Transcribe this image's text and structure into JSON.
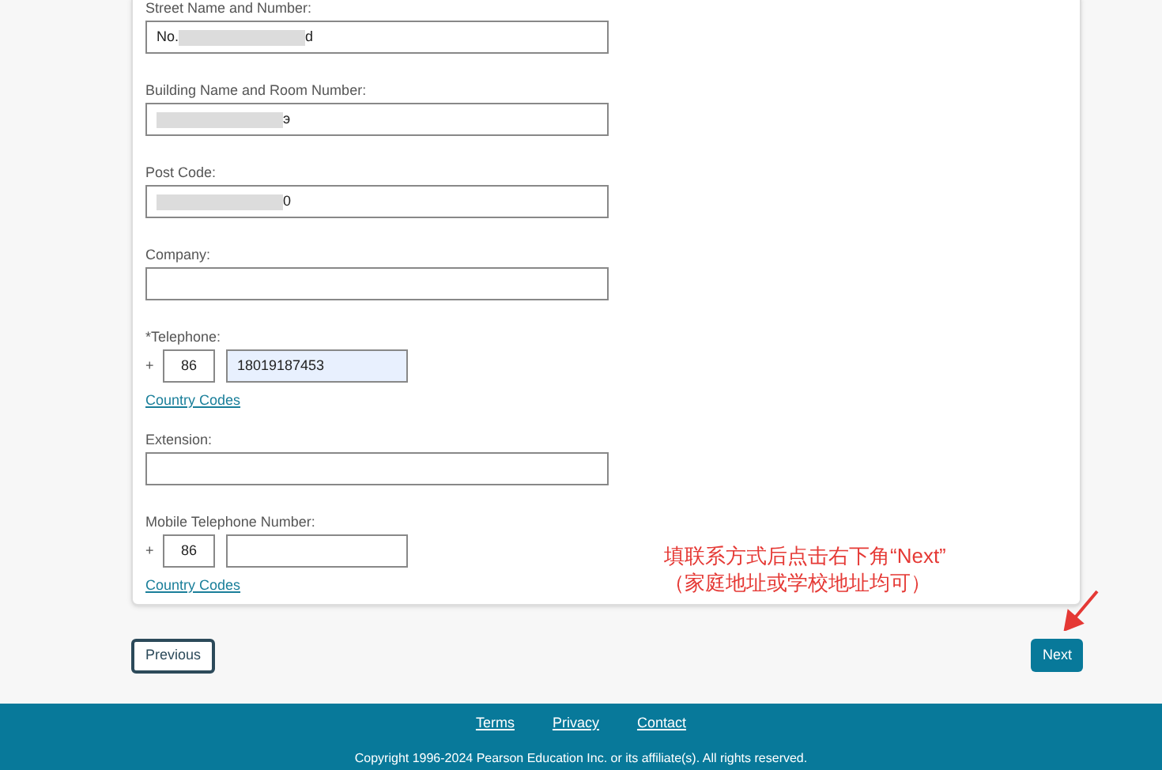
{
  "form": {
    "fields": [
      {
        "kind": "text",
        "label": "Street Name and Number:",
        "value_start": "No.",
        "value_end": "d",
        "redacted": true
      },
      {
        "kind": "text",
        "label": "Building Name and Room Number:",
        "value_end": "э",
        "redacted": true
      },
      {
        "kind": "text",
        "label": "Post Code:",
        "value_end": "0",
        "redacted": true
      },
      {
        "kind": "text",
        "label": "Company:"
      },
      {
        "kind": "phone",
        "label": "*Telephone:",
        "plus": "+",
        "country_code": "86",
        "number": "18019187453",
        "autofilled": true,
        "link": "Country Codes"
      },
      {
        "kind": "text",
        "label": "Extension:"
      },
      {
        "kind": "phone",
        "label": "Mobile Telephone Number:",
        "plus": "+",
        "country_code": "86",
        "autofilled": false,
        "link": "Country Codes"
      }
    ]
  },
  "annotation": {
    "lines": [
      "填联系方式后点击右下角“Next”",
      "（家庭地址或学校地址均可）"
    ]
  },
  "buttons": {
    "previous": "Previous",
    "next": "Next"
  },
  "footer": {
    "links": [
      "Terms",
      "Privacy",
      "Contact"
    ],
    "copyright": "Copyright 1996-2024 Pearson Education Inc. or its affiliate(s). All rights reserved."
  }
}
